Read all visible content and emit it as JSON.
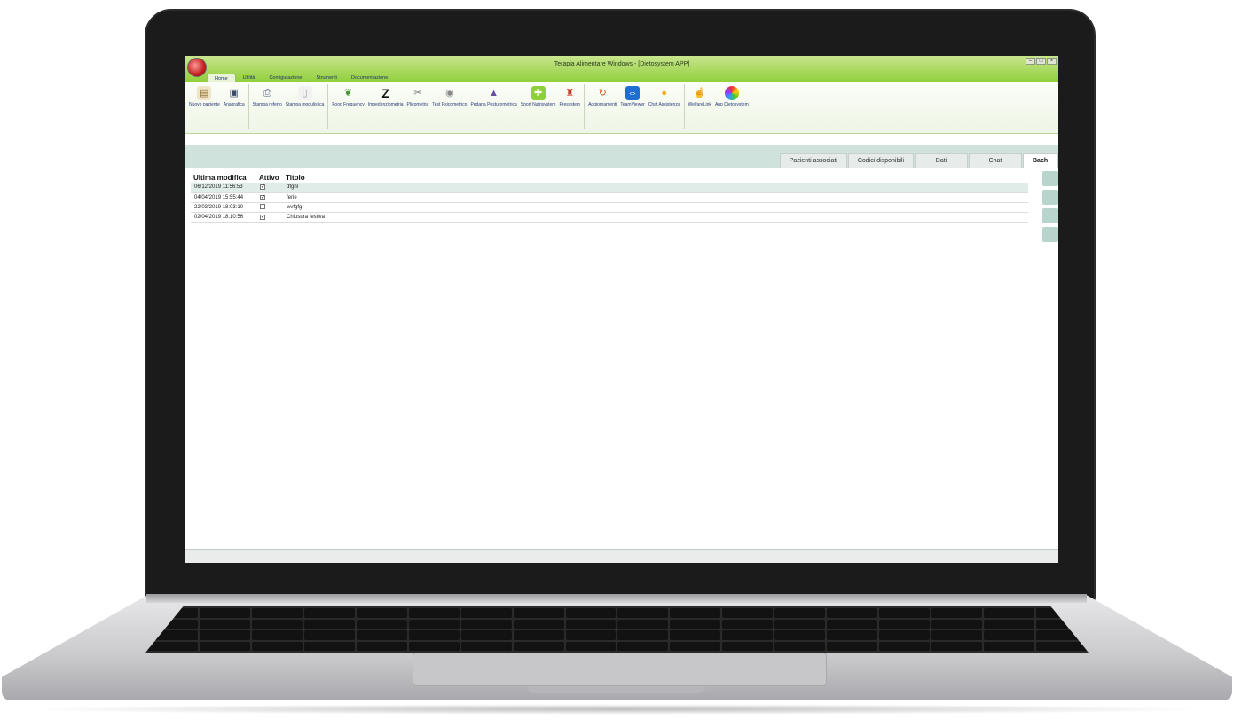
{
  "window": {
    "title": "Terapia Alimentare Windows - [Dietosystem APP]"
  },
  "menu": [
    {
      "label": "Home"
    },
    {
      "label": "Utilità"
    },
    {
      "label": "Configurazione"
    },
    {
      "label": "Strumenti"
    },
    {
      "label": "Documentazione"
    }
  ],
  "ribbon": [
    {
      "label": "Nuovo paziente",
      "icon": "clipboard-icon"
    },
    {
      "label": "Anagrafica",
      "icon": "id-card-icon"
    },
    {
      "label": "Stampa referto",
      "icon": "printer-icon"
    },
    {
      "label": "Stampa modulistica",
      "icon": "document-icon"
    },
    {
      "label": "Food Frequency",
      "icon": "food-icon"
    },
    {
      "label": "Impedenziometria",
      "icon": "z-icon"
    },
    {
      "label": "Plicometria",
      "icon": "caliper-icon"
    },
    {
      "label": "Test Psicometrico",
      "icon": "brain-icon"
    },
    {
      "label": "Pedana Posturometrica",
      "icon": "scale-icon"
    },
    {
      "label": "Sport Nutrisystem",
      "icon": "sport-icon"
    },
    {
      "label": "Presystem",
      "icon": "posture-icon"
    },
    {
      "label": "Aggiornamenti",
      "icon": "refresh-icon"
    },
    {
      "label": "TeamViewer",
      "icon": "teamviewer-icon"
    },
    {
      "label": "Chat Assistenza",
      "icon": "chat-icon"
    },
    {
      "label": "WelfareLink",
      "icon": "hand-icon"
    },
    {
      "label": "App Dietosystem",
      "icon": "app-icon"
    }
  ],
  "tabs": [
    {
      "label": "Pazienti associati"
    },
    {
      "label": "Codici disponibili"
    },
    {
      "label": "Dati"
    },
    {
      "label": "Chat"
    },
    {
      "label": "Bach"
    }
  ],
  "table": {
    "headers": [
      "Ultima modifica",
      "Attivo",
      "Titolo"
    ],
    "rows": [
      {
        "date": "06/12/2019 11:56:53",
        "active": true,
        "title": "dfghl"
      },
      {
        "date": "04/04/2019 15:55:44",
        "active": true,
        "title": "ferie"
      },
      {
        "date": "22/03/2019 18:03:10",
        "active": false,
        "title": "wvfgfg"
      },
      {
        "date": "02/04/2019 18:10:56",
        "active": true,
        "title": "Chiusura festiva"
      }
    ]
  },
  "colors": {
    "titlebar": "#8fcf3a",
    "band": "#cfe2dc",
    "selected_row": "#dfece8"
  }
}
